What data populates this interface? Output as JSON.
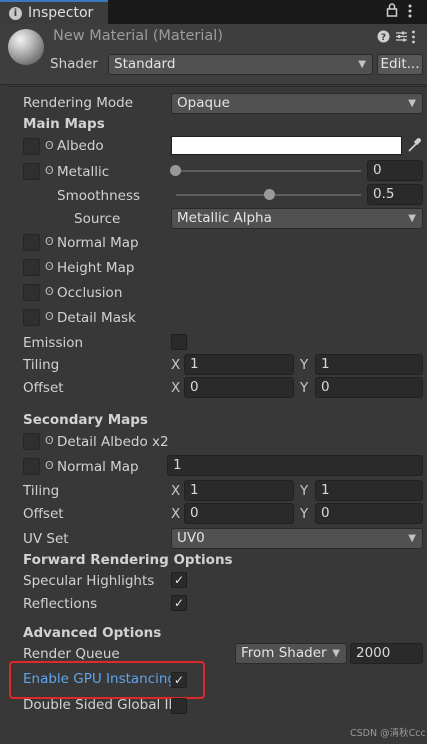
{
  "tab": {
    "title": "Inspector",
    "lock_icon": "lock-icon",
    "menu_icon": "kebab-menu-icon"
  },
  "material": {
    "name": "New Material (Material)",
    "shader_label": "Shader",
    "shader_value": "Standard",
    "edit_button": "Edit..."
  },
  "props": {
    "rendering_mode_label": "Rendering Mode",
    "rendering_mode_value": "Opaque",
    "main_maps": "Main Maps",
    "albedo": "Albedo",
    "metallic": "Metallic",
    "metallic_value": "0",
    "smoothness": "Smoothness",
    "smoothness_value": "0.5",
    "smoothness_fraction": 0.5,
    "source": "Source",
    "source_value": "Metallic Alpha",
    "normal_map": "Normal Map",
    "height_map": "Height Map",
    "occlusion": "Occlusion",
    "detail_mask": "Detail Mask",
    "emission": "Emission",
    "tiling": "Tiling",
    "offset": "Offset",
    "x": "X",
    "y": "Y",
    "main_tiling_x": "1",
    "main_tiling_y": "1",
    "main_offset_x": "0",
    "main_offset_y": "0",
    "secondary_maps": "Secondary Maps",
    "detail_albedo": "Detail Albedo x2",
    "secondary_normal_map": "Normal Map",
    "secondary_normal_value": "1",
    "sec_tiling_x": "1",
    "sec_tiling_y": "1",
    "sec_offset_x": "0",
    "sec_offset_y": "0",
    "uv_set": "UV Set",
    "uv_set_value": "UV0",
    "forward_rendering": "Forward Rendering Options",
    "specular_highlights": "Specular Highlights",
    "reflections": "Reflections",
    "advanced_options": "Advanced Options",
    "render_queue": "Render Queue",
    "render_queue_source": "From Shader",
    "render_queue_value": "2000",
    "gpu_instancing": "Enable GPU Instancing",
    "double_sided": "Double Sided Global Illu",
    "check_glyph": "✓"
  },
  "colors": {
    "accent_blue": "#5ea5ec",
    "highlight_red": "#e0282a"
  },
  "watermark": "CSDN @清秋Ccc"
}
